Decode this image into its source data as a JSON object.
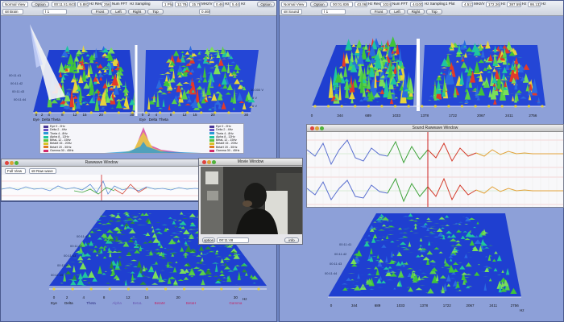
{
  "brain_window": {
    "view_mode": "Normal View",
    "option_label": "Option",
    "values": [
      "00:11:41.843",
      "5.883",
      "Hz Res",
      "256",
      "Num FFT",
      "1 Plot",
      "12.784",
      "Hz Sampling",
      "1 Plot",
      "15.784",
      "MHz/V",
      "0.469",
      "Hz",
      "5.441",
      "Hz",
      "0.469",
      "Hz"
    ],
    "source": "s8 Brain",
    "channel": "Ⅰ 1",
    "sample_value": "0.469",
    "nav_buttons": [
      "Front",
      "Left",
      "Right",
      "Top"
    ],
    "bottom_left_axis": [
      "0",
      "2",
      "4",
      "8",
      "12",
      "15",
      "20",
      "30"
    ],
    "bottom_right_axis": [
      "0",
      "2",
      "4",
      "8",
      "12",
      "15",
      "20",
      "30"
    ],
    "axis_unit": "Hz",
    "band_labels_left": [
      "Eye",
      "Delta",
      "Theta",
      "Alpha",
      "BetaL",
      "BetaM",
      "BetaH",
      "Gamma"
    ],
    "band_labels_right": [
      "Eye",
      "Delta",
      "Theta",
      "Alpha",
      "BetaL",
      "BetaM",
      "BetaH",
      "Gamma"
    ],
    "side_time_labels": [
      "00:11:41",
      "00:11:42",
      "00:11:43",
      "00:11:44",
      "00:11:45",
      "00:11:46"
    ],
    "right_side_labels": [
      "10.000 V",
      "8 V",
      "6 V",
      "4 V"
    ],
    "legend_rows": [
      {
        "label": "Eye 0 - 2Hz",
        "color": "#4b3a98"
      },
      {
        "label": "Delta 2 - 4Hz",
        "color": "#6b55c4"
      },
      {
        "label": "Theta 4 - 8Hz",
        "color": "#2a9ad6"
      },
      {
        "label": "Alpha 8 - 12Hz",
        "color": "#1fc5a0"
      },
      {
        "label": "BetaL 12 - 15Hz",
        "color": "#58c23a"
      },
      {
        "label": "BetaM 15 - 20Hz",
        "color": "#d8c22a"
      },
      {
        "label": "BetaH 20 - 30Hz",
        "color": "#e07a22"
      },
      {
        "label": "Gamma 30 - 45Hz",
        "color": "#d42a6a"
      }
    ]
  },
  "sound_window": {
    "view_mode": "Normal View",
    "option_label": "Option",
    "values": [
      "00:01.836",
      "43.068",
      "Hz Res",
      "1024",
      "Num FFT",
      "44100",
      "Hz Sampling",
      "1 Plot",
      "4.517",
      "MHz/V",
      "172.266",
      "Hz",
      "387.598",
      "Hz",
      "86.133",
      "Hz"
    ],
    "source": "s8 Sound",
    "channel": "Ⅰ 1",
    "nav_buttons": [
      "Front",
      "Left",
      "Right",
      "Top"
    ],
    "top_axis": [
      "0",
      "344",
      "689",
      "1033",
      "1378",
      "1722",
      "2067",
      "2411",
      "2756"
    ],
    "bottom_axis": [
      "0",
      "344",
      "689",
      "1033",
      "1378",
      "1722",
      "2067",
      "2411",
      "2756"
    ],
    "axis_unit": "Hz",
    "side_time_labels": [
      "00:11:41",
      "00:11:42",
      "00:11:43",
      "00:11:44",
      "00:11:45",
      "00:11:46"
    ]
  },
  "rawwave_window": {
    "title": "Rawwave Window",
    "view_mode": "Full View",
    "filter": "s8 Raw wave"
  },
  "movie_window": {
    "title": "Movie Window",
    "option_label": "option",
    "timestamp": "00:11:48",
    "info_label": "info"
  },
  "sound_rawwave_window": {
    "title": "Sound Rawwave Window"
  },
  "colors": {
    "desktop": "#6f86c4",
    "panel": "#8da0d8",
    "surface_blue": "#1f3fd0",
    "peak_green": "#3fc43a",
    "peak_red": "#e23a2a",
    "peak_yellow": "#e8d43a"
  }
}
